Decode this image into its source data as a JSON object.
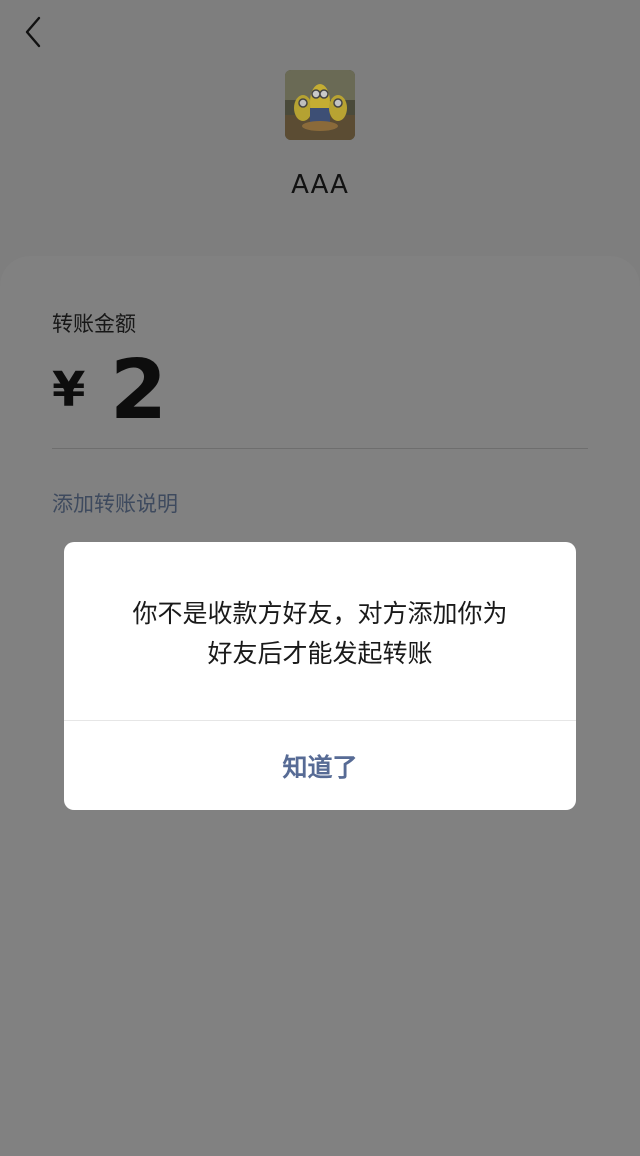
{
  "header": {
    "back_icon": "chevron-left-icon",
    "payee_name": "AAA"
  },
  "transfer": {
    "amount_label": "转账金额",
    "currency_symbol": "¥",
    "amount": "2",
    "add_note_label": "添加转账说明"
  },
  "dialog": {
    "message_line1": "你不是收款方好友，对方添加你为",
    "message_line2": "好友后才能发起转账",
    "confirm_label": "知道了"
  },
  "colors": {
    "link": "#576b95",
    "overlay": "#7e7e7e"
  }
}
